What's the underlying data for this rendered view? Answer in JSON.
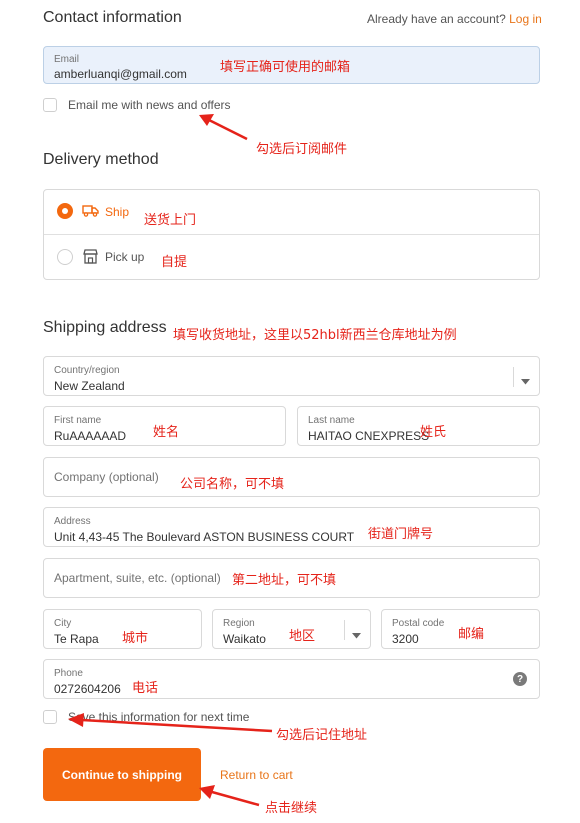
{
  "contact": {
    "title": "Contact information",
    "already_text": "Already have an account?",
    "login_label": "Log in",
    "email_label": "Email",
    "email_value": "amberluanqi@gmail.com",
    "newsletter_label": "Email me with news and offers"
  },
  "delivery": {
    "title": "Delivery method",
    "ship_label": "Ship",
    "pickup_label": "Pick up"
  },
  "shipping": {
    "title": "Shipping address",
    "country_label": "Country/region",
    "country_value": "New Zealand",
    "first_name_label": "First name",
    "first_name_value": "RuAAAAAAD",
    "last_name_label": "Last name",
    "last_name_value": "HAITAO CNEXPRESS",
    "company_placeholder": "Company (optional)",
    "address_label": "Address",
    "address_value": "Unit 4,43-45 The Boulevard ASTON BUSINESS COURT",
    "apartment_placeholder": "Apartment, suite, etc. (optional)",
    "city_label": "City",
    "city_value": "Te Rapa",
    "region_label": "Region",
    "region_value": "Waikato",
    "postal_label": "Postal code",
    "postal_value": "3200",
    "phone_label": "Phone",
    "phone_value": "0272604206",
    "save_info_label": "Save this information for next time"
  },
  "actions": {
    "continue_label": "Continue to shipping",
    "return_label": "Return to cart"
  },
  "annotations": {
    "email": "填写正确可使用的邮箱",
    "subscribe": "勾选后订阅邮件",
    "ship": "送货上门",
    "pickup": "自提",
    "shipping_address": "填写收货地址，这里以52hbl新西兰仓库地址为例",
    "first_name": "姓名",
    "last_name": "姓氏",
    "company": "公司名称，可不填",
    "address": "街道门牌号",
    "apartment": "第二地址，可不填",
    "city": "城市",
    "region": "地区",
    "postal": "邮编",
    "phone": "电话",
    "save_info": "勾选后记住地址",
    "continue": "点击继续"
  },
  "colors": {
    "accent": "#f3680f",
    "annotation": "#e5231a",
    "email_bg": "#eaf1fb"
  },
  "icons": [
    "truck-icon",
    "store-icon",
    "chevron-down-icon",
    "help-icon",
    "arrow-icon"
  ]
}
